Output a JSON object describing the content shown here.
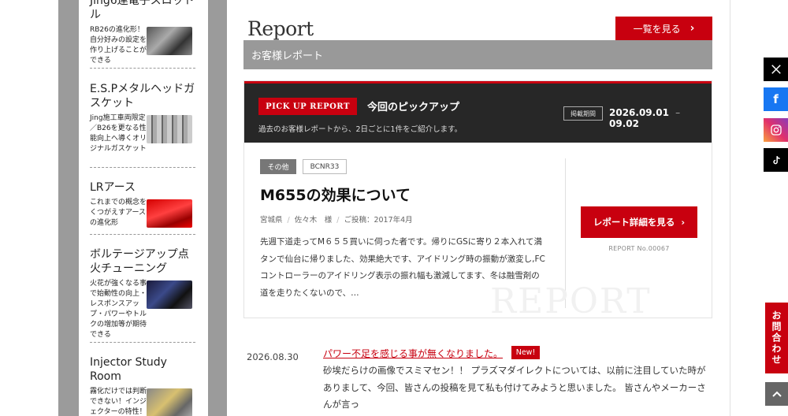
{
  "sidebar": {
    "items": [
      {
        "title": "Jing6連電子スロットル",
        "desc": "RB26の進化形！自分好みの設定を作り上げることができる"
      },
      {
        "title": "E.S.Pメタルヘッドガスケット",
        "desc": "Jing施工車両限定／B26を更なる性能向上へ導くオリジナルガスケット"
      },
      {
        "title": "LRアース",
        "desc": "これまでの概念をくつがえすアースの進化形"
      },
      {
        "title": "ボルテージアップ点火チューニング",
        "desc": "火花が強くなる事で始動性の向上・レスポンスアップ・パワーやトルクの増加等が期待できる"
      },
      {
        "title": "Injector Study Room",
        "desc": "霧化だけでは判断できない！インジェクターの特性！"
      }
    ]
  },
  "main": {
    "section_title": "Report",
    "view_all_label": "一覧を見る",
    "category_label": "お客様レポート",
    "pickup": {
      "badge": "PICK UP REPORT",
      "title": "今回のピックアップ",
      "subtitle": "過去のお客様レポートから、2日ごとに1件をご紹介します。",
      "period_label": "掲載期間",
      "period_start": "2026.09.01",
      "period_sep": "–",
      "period_end": "09.02",
      "tags": [
        "その他",
        "BCNR33"
      ],
      "entry_title": "M655の効果について",
      "meta_pref": "宮城県",
      "meta_name": "佐々木　様",
      "meta_date": "ご投稿：2017年4月",
      "excerpt": "先週下道走ってM６５５買いに伺った者です。帰りにGSに寄り２本入れて満タンで仙台に帰りました、効果絶大です、アイドリング時の振動が激変し,FCコントローラーのアイドリング表示の振れ幅も激減してます、冬は融雪剤の道を走りたくないので、…",
      "detail_label": "レポート詳細を見る",
      "report_no": "REPORT No.00067",
      "watermark": "REPORT"
    },
    "latest": {
      "date": "2026.08.30",
      "title": "パワー不足を感じる事が無くなりました。",
      "badge": "New!",
      "text": "砂埃だらけの画像でスミマセン！！ プラズマダイレクトについては、以前に注目していた時がありまして、今回、皆さんの投稿を見て私も付けてみようと思いました。 皆さんやメーカーさんが言っ"
    }
  },
  "social": {
    "x_icon": "X",
    "facebook_icon": "f",
    "instagram_icon": "instagram",
    "tiktok_icon": "tiktok"
  },
  "contact_label": "お問合わせ",
  "colors": {
    "accent": "#c8000f",
    "dark": "#272727",
    "gray_bar": "#999999"
  }
}
